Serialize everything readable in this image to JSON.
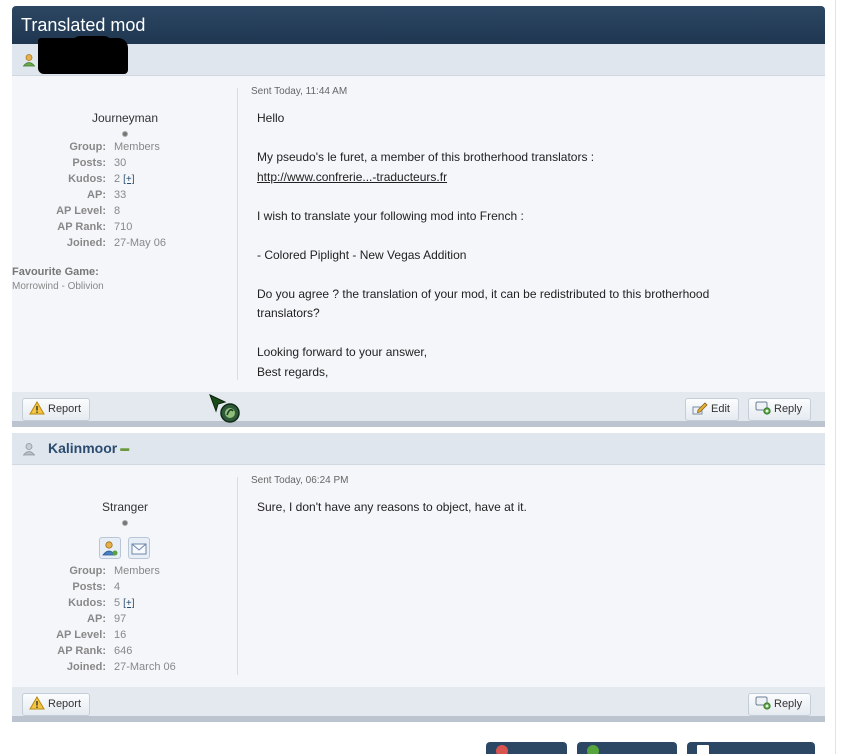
{
  "topic": {
    "title": "Translated mod"
  },
  "posts": [
    {
      "author": "",
      "user": {
        "title": "Journeyman",
        "stats": [
          {
            "label": "Group:",
            "value": "Members"
          },
          {
            "label": "Posts:",
            "value": "30"
          },
          {
            "label": "Kudos:",
            "value": "2",
            "extra": "[+]"
          },
          {
            "label": "AP:",
            "value": "33"
          },
          {
            "label": "AP Level:",
            "value": "8"
          },
          {
            "label": "AP Rank:",
            "value": "710"
          },
          {
            "label": "Joined:",
            "value": "27-May 06"
          }
        ],
        "favourite_label": "Favourite Game:",
        "favourite_value": "Morrowind - Oblivion"
      },
      "date": "Sent Today, 11:44 AM",
      "lines": [
        "Hello",
        "My pseudo's le furet, a member of this brotherhood translators :",
        "http://www.confrerie...-traducteurs.fr",
        "I wish to translate your following mod into French :",
        "- Colored Piplight - New Vegas Addition",
        "Do you agree ? the translation of your mod, it can be redistributed to this brotherhood",
        "translators?",
        "Looking forward to your answer,",
        "Best regards,"
      ],
      "buttons": {
        "report": "Report",
        "edit": "Edit",
        "reply": "Reply"
      }
    },
    {
      "author": "Kalinmoor",
      "user": {
        "title": "Stranger",
        "stats": [
          {
            "label": "Group:",
            "value": "Members"
          },
          {
            "label": "Posts:",
            "value": "4"
          },
          {
            "label": "Kudos:",
            "value": "5",
            "extra": "[+]"
          },
          {
            "label": "AP:",
            "value": "97"
          },
          {
            "label": "AP Level:",
            "value": "16"
          },
          {
            "label": "AP Rank:",
            "value": "646"
          },
          {
            "label": "Joined:",
            "value": "27-March 06"
          }
        ]
      },
      "date": "Sent Today, 06:24 PM",
      "lines": [
        "Sure, I don't have any reasons to object, have at it."
      ],
      "buttons": {
        "report": "Report",
        "reply": "Reply"
      }
    }
  ],
  "colors": {
    "header": "#1f3650",
    "accent": "#2b4c6f",
    "panel": "#f4f6f9"
  },
  "icons": {
    "online": "user-online-icon",
    "offline": "user-offline-icon",
    "report": "warning-triangle-icon",
    "edit": "edit-pencil-icon",
    "reply": "reply-bubble-icon",
    "profile": "profile-card-icon",
    "message": "send-message-icon"
  }
}
